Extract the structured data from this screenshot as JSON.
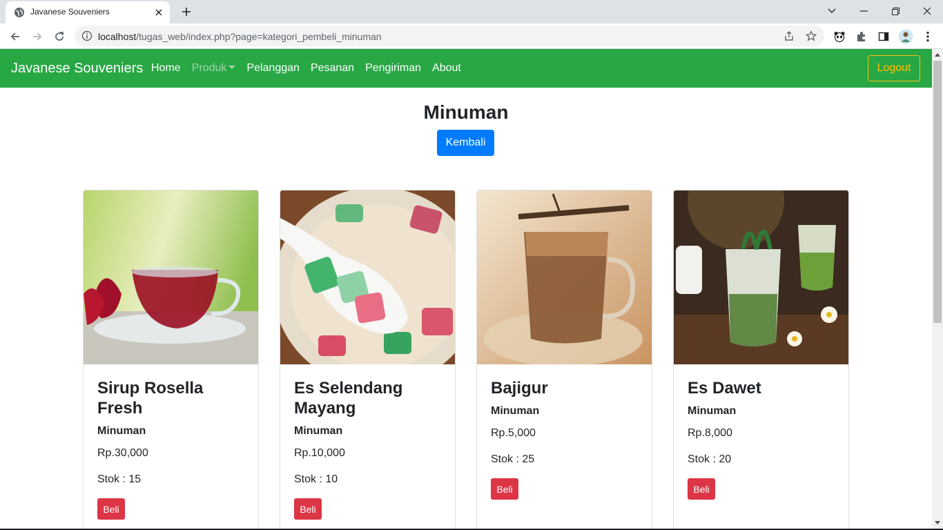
{
  "browser": {
    "tab_title": "Javanese Souveniers",
    "url_host": "localhost",
    "url_path": "/tugas_web/index.php?page=kategori_pembeli_minuman"
  },
  "navbar": {
    "brand": "Javanese Souveniers",
    "links": [
      {
        "label": "Home"
      },
      {
        "label": "Produk"
      },
      {
        "label": "Pelanggan"
      },
      {
        "label": "Pesanan"
      },
      {
        "label": "Pengiriman"
      },
      {
        "label": "About"
      }
    ],
    "logout": "Logout"
  },
  "page": {
    "title": "Minuman",
    "back_button": "Kembali"
  },
  "products": [
    {
      "name": "Sirup Rosella Fresh",
      "category": "Minuman",
      "price": "Rp.30,000",
      "stock": "Stok : 15",
      "buy_label": "Beli"
    },
    {
      "name": "Es Selendang Mayang",
      "category": "Minuman",
      "price": "Rp.10,000",
      "stock": "Stok : 10",
      "buy_label": "Beli"
    },
    {
      "name": "Bajigur",
      "category": "Minuman",
      "price": "Rp.5,000",
      "stock": "Stok : 25",
      "buy_label": "Beli"
    },
    {
      "name": "Es Dawet",
      "category": "Minuman",
      "price": "Rp.8,000",
      "stock": "Stok : 20",
      "buy_label": "Beli"
    }
  ],
  "colors": {
    "navbar_green": "#28a745",
    "logout_yellow": "#ffc107",
    "primary_blue": "#007bff",
    "danger_red": "#dc3545"
  }
}
